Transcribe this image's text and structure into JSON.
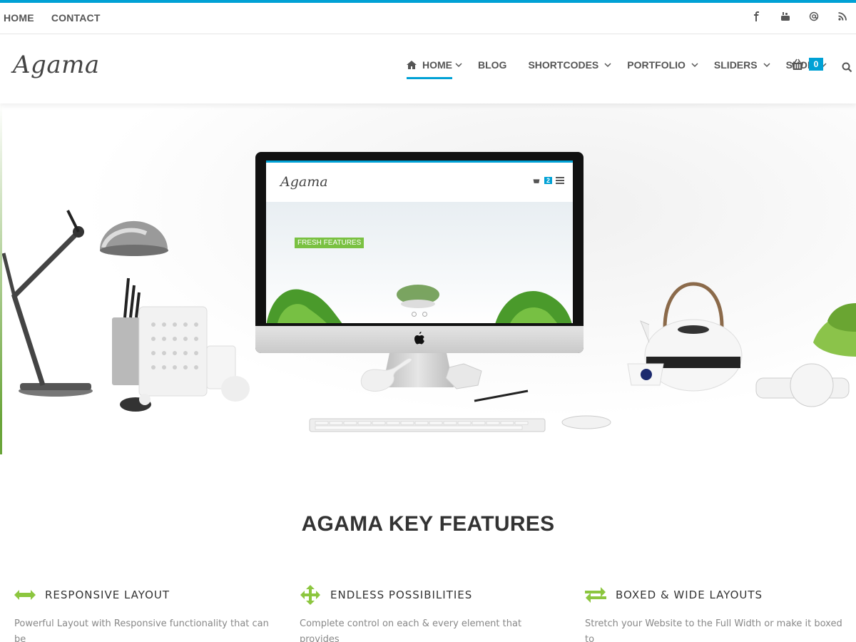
{
  "topbar": {
    "links": [
      "HOME",
      "CONTACT"
    ],
    "social_icons": [
      "facebook-icon",
      "youtube-icon",
      "at-icon",
      "rss-icon"
    ]
  },
  "header": {
    "logo": "Agama",
    "nav": [
      {
        "label": "HOME",
        "active": true,
        "dropdown": true
      },
      {
        "label": "BLOG",
        "active": false,
        "dropdown": false
      },
      {
        "label": "SHORTCODES",
        "active": false,
        "dropdown": true
      },
      {
        "label": "PORTFOLIO",
        "active": false,
        "dropdown": true
      },
      {
        "label": "SLIDERS",
        "active": false,
        "dropdown": true
      },
      {
        "label": "SHOP",
        "active": false,
        "dropdown": true
      }
    ],
    "cart_count": "0"
  },
  "hero": {
    "screen_logo": "Agama",
    "screen_cart_count": "2",
    "screen_tag": "FRESH FEATURES"
  },
  "features": {
    "title": "AGAMA KEY FEATURES",
    "items": [
      {
        "title": "RESPONSIVE LAYOUT",
        "icon": "horizontal-arrows-icon",
        "desc": "Powerful Layout with Responsive functionality that can be"
      },
      {
        "title": "ENDLESS POSSIBILITIES",
        "icon": "move-arrows-icon",
        "desc": "Complete control on each & every element that provides"
      },
      {
        "title": "BOXED & WIDE LAYOUTS",
        "icon": "swap-arrows-icon",
        "desc": "Stretch your Website to the Full Width or make it boxed to"
      }
    ]
  },
  "colors": {
    "accent": "#00a1d5",
    "feature_icon": "#8cc63f"
  }
}
